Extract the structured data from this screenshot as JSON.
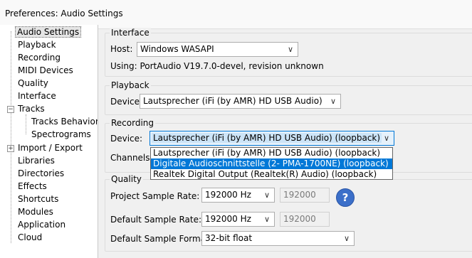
{
  "window": {
    "title": "Preferences: Audio Settings"
  },
  "tree": {
    "items": [
      {
        "label": "Audio Settings",
        "selected": true
      },
      {
        "label": "Playback"
      },
      {
        "label": "Recording"
      },
      {
        "label": "MIDI Devices"
      },
      {
        "label": "Quality"
      },
      {
        "label": "Interface"
      },
      {
        "label": "Tracks",
        "expanded": true
      },
      {
        "label": "Tracks Behaviors"
      },
      {
        "label": "Spectrograms"
      },
      {
        "label": "Import / Export",
        "expanded": false
      },
      {
        "label": "Libraries"
      },
      {
        "label": "Directories"
      },
      {
        "label": "Effects"
      },
      {
        "label": "Shortcuts"
      },
      {
        "label": "Modules"
      },
      {
        "label": "Application"
      },
      {
        "label": "Cloud"
      }
    ],
    "expander_minus": "−",
    "expander_plus": "+"
  },
  "interface": {
    "title": "Interface",
    "host_label": "Host:",
    "host_value": "Windows WASAPI",
    "using_text": "Using: PortAudio V19.7.0-devel, revision unknown"
  },
  "playback": {
    "title": "Playback",
    "device_label": "Device:",
    "device_value": "Lautsprecher (iFi (by AMR) HD USB Audio)"
  },
  "recording": {
    "title": "Recording",
    "device_label": "Device:",
    "device_value": "Lautsprecher (iFi (by AMR) HD USB Audio) (loopback)",
    "channels_label": "Channels:",
    "options": [
      "Lautsprecher (iFi (by AMR) HD USB Audio) (loopback)",
      "Digitale Audioschnittstelle (2- PMA-1700NE) (loopback)",
      "Realtek Digital Output (Realtek(R) Audio) (loopback)"
    ],
    "highlighted_option": 1
  },
  "quality": {
    "title": "Quality",
    "project_rate_label": "Project Sample Rate:",
    "project_rate_value": "192000 Hz",
    "project_rate_text": "192000",
    "default_rate_label": "Default Sample Rate:",
    "default_rate_value": "192000 Hz",
    "default_rate_text": "192000",
    "default_format_label": "Default Sample Format:",
    "default_format_value": "32-bit float",
    "help_glyph": "?"
  },
  "icons": {
    "chevron": "∨"
  }
}
